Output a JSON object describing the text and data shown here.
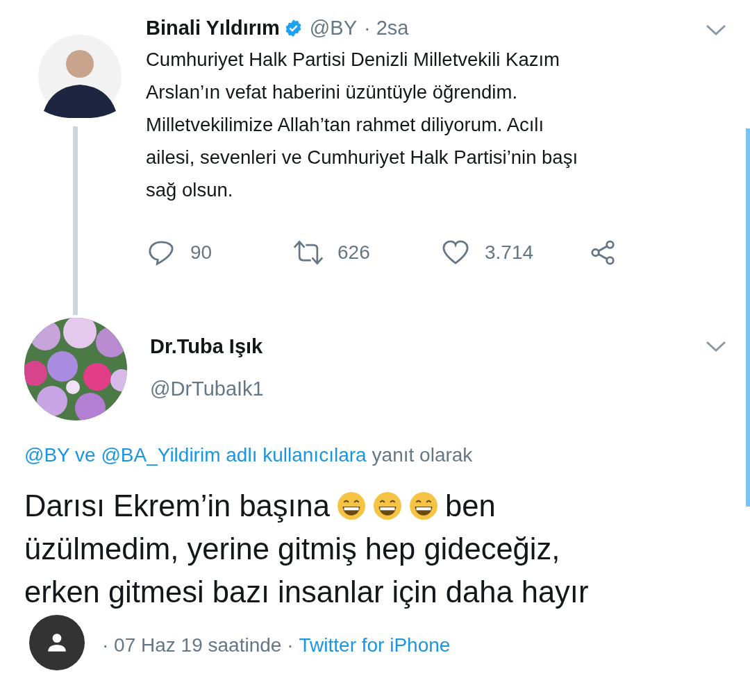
{
  "tweet": {
    "name": "Binali Yıldırım",
    "verified": true,
    "handle": "@BY",
    "time": "· 2sa",
    "text": "Cumhuriyet Halk Partisi Denizli Milletvekili Kazım\nArslan’ın vefat haberini üzüntüyle öğrendim.\nMilletvekilimize Allah’tan rahmet diliyorum. Acılı\nailesi, sevenleri ve Cumhuriyet Halk Partisi’nin başı\nsağ olsun.",
    "actions": [
      {
        "kind": "reply",
        "count": "90"
      },
      {
        "kind": "retweet",
        "count": "626"
      },
      {
        "kind": "like",
        "count": "3.714"
      },
      {
        "kind": "share"
      }
    ]
  },
  "reply": {
    "name": "Dr.Tuba Işık",
    "handle": "@DrTubaIk1",
    "replying_to": {
      "link": "@BY ve @BA_Yildirim adlı kullanıcılara",
      "text": "yanıt olarak"
    },
    "body_first_line": [
      {
        "kind": "text",
        "text": "Darısı Ekrem’in başına"
      },
      {
        "kind": "emoji"
      },
      {
        "kind": "emoji"
      },
      {
        "kind": "emoji"
      },
      {
        "kind": "text",
        "text": "ben"
      }
    ],
    "body_rest": "üzülmedim, yerine gitmiş hep gideceğiz,\nerken gitmesi bazı insanlar için daha hayır",
    "timestamp": "· 07 Haz 19 saatinde ·",
    "source": "Twitter for iPhone"
  }
}
